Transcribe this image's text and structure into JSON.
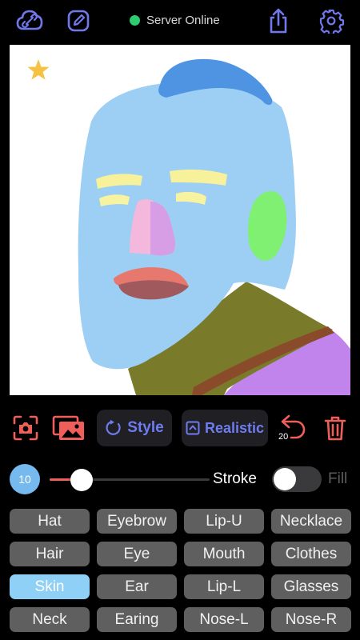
{
  "header": {
    "status_text": "Server Online",
    "status_color": "#2ecc71",
    "icons": [
      "link-icon",
      "edit-icon",
      "share-icon",
      "gear-icon"
    ],
    "icon_color": "#7078ec"
  },
  "toolbar": {
    "style_label": "Style",
    "realistic_label": "Realistic",
    "undo_count": "20",
    "tool_color": "#ee5f5b",
    "icons": [
      "camera-icon",
      "gallery-icon",
      "undo-icon",
      "trash-icon"
    ]
  },
  "brush": {
    "size": "10",
    "size_color": "#76b9ee",
    "stroke_fraction": 0.2,
    "stroke_label": "Stroke",
    "fill_label": "Fill",
    "fill_enabled": false
  },
  "labels": {
    "items": [
      "Hat",
      "Eyebrow",
      "Lip-U",
      "Necklace",
      "Hair",
      "Eye",
      "Mouth",
      "Clothes",
      "Skin",
      "Ear",
      "Lip-L",
      "Glasses",
      "Neck",
      "Earing",
      "Nose-L",
      "Nose-R"
    ],
    "selected": "Skin",
    "selected_color": "#8ed0f6"
  },
  "canvas": {
    "star_color": "#f5c242",
    "segment_colors": {
      "skin": "#9dcef3",
      "hair": "#4f94e3",
      "eyebrow": "#f6f19a",
      "eye": "#f8f3a0",
      "nose_left": "#f4b8dc",
      "nose_right": "#d79ee6",
      "ear": "#7ff072",
      "lip_upper": "#e7786e",
      "lip_lower": "#a05a5e",
      "neck": "#7a7a2b",
      "clothes": "#c184ec",
      "strap": "#8a4b2a"
    }
  }
}
